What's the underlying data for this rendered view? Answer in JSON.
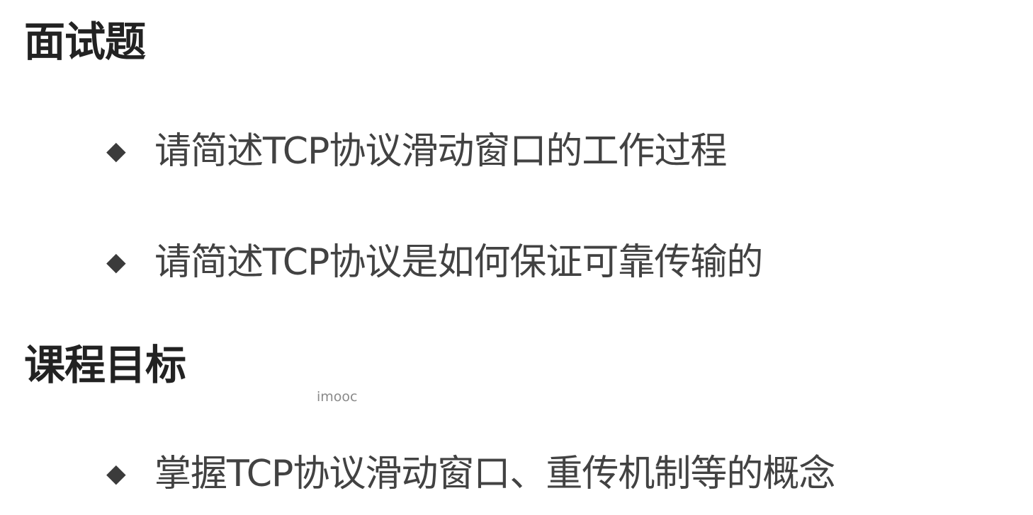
{
  "sections": [
    {
      "title": "面试题",
      "items": [
        "请简述TCP协议滑动窗口的工作过程",
        "请简述TCP协议是如何保证可靠传输的"
      ]
    },
    {
      "title": "课程目标",
      "items": [
        "掌握TCP协议滑动窗口、重传机制等的概念"
      ]
    }
  ],
  "bullet_glyph": "◆",
  "watermark": "imooc",
  "colors": {
    "heading": "#222222",
    "text": "#424242",
    "bullet": "#3b3b3b",
    "watermark": "#8a8a8a",
    "background": "#ffffff"
  }
}
